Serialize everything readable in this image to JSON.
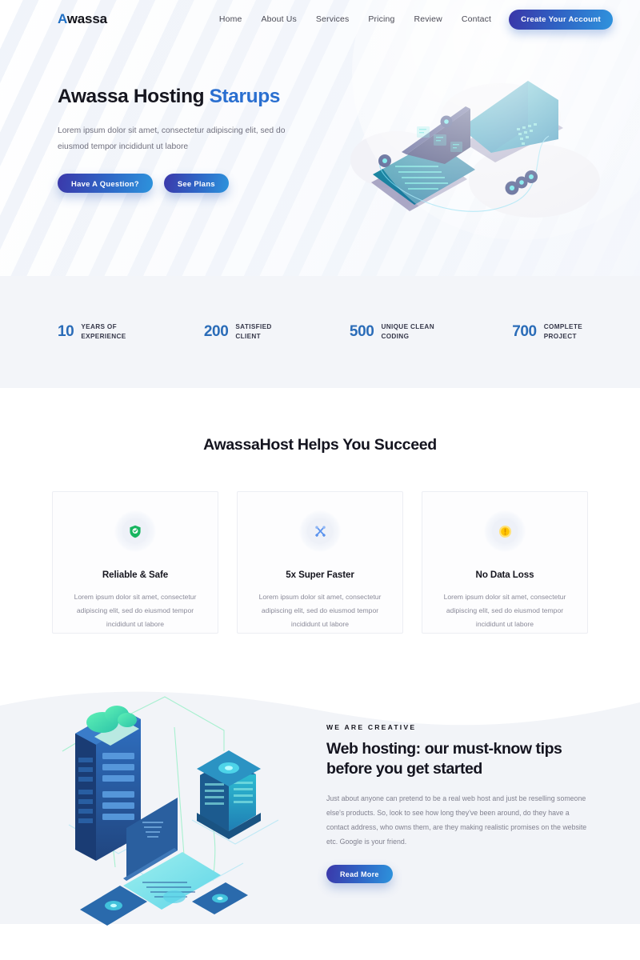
{
  "brand": {
    "first_letter": "A",
    "rest": "wassa"
  },
  "nav": {
    "links": [
      {
        "label": "Home"
      },
      {
        "label": "About Us"
      },
      {
        "label": "Services"
      },
      {
        "label": "Pricing"
      },
      {
        "label": "Review"
      },
      {
        "label": "Contact"
      }
    ],
    "cta_label": "Create Your Account"
  },
  "hero": {
    "title_main": "Awassa Hosting ",
    "title_accent": "Starups",
    "subtitle": "Lorem ipsum dolor sit amet, consectetur adipiscing elit, sed do eiusmod tempor incididunt ut labore",
    "btn_primary": "Have A Question?",
    "btn_secondary": "See Plans",
    "illustration_name": "isometric-laptop-monitor-illustration"
  },
  "stats": [
    {
      "number": "10",
      "label": "YEARS OF\nEXPERIENCE"
    },
    {
      "number": "200",
      "label": "SATISFIED\nCLIENT"
    },
    {
      "number": "500",
      "label": "UNIQUE CLEAN\nCODING"
    },
    {
      "number": "700",
      "label": "COMPLETE\nPROJECT"
    }
  ],
  "features": {
    "heading": "AwassaHost Helps You Succeed",
    "cards": [
      {
        "icon": "shield-check-icon",
        "icon_color": "#18b560",
        "title": "Reliable & Safe",
        "text": "Lorem ipsum dolor sit amet, consectetur adipiscing elit, sed do eiusmod tempor incididunt ut labore"
      },
      {
        "icon": "tools-wrench-screwdriver-icon",
        "icon_color": "#5b93ee",
        "title": "5x Super Faster",
        "text": "Lorem ipsum dolor sit amet, consectetur adipiscing elit, sed do eiusmod tempor incididunt ut labore"
      },
      {
        "icon": "warning-exclamation-icon",
        "icon_color": "#ffc400",
        "title": "No Data Loss",
        "text": "Lorem ipsum dolor sit amet, consectetur adipiscing elit, sed do eiusmod tempor incididunt ut labore"
      }
    ]
  },
  "lower": {
    "eyebrow": "We Are Creative",
    "title": "Web hosting: our must-know tips before you get started",
    "text": "Just about anyone can pretend to be a real web host and just be reselling someone else's products. So, look to see how long they've been around, do they have a contact address, who owns them, are they making realistic promises on the website etc. Google is your friend.",
    "button_label": "Read More",
    "illustration_name": "isometric-datacenter-cloud-illustration"
  },
  "colors": {
    "accent_blue": "#2a6fd0",
    "stat_blue": "#2a6cb8",
    "grad_start": "#3b38aa",
    "grad_end": "#2d93dc",
    "band_bg": "#f3f5f9",
    "lower_bg": "#f2f4f8"
  }
}
